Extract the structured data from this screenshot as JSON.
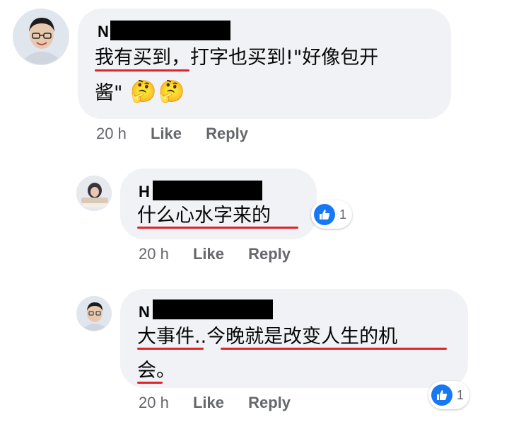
{
  "comments": [
    {
      "author_initial": "N",
      "text_line1": "我有买到，打字也买到!\"好像包开",
      "text_line2": "酱\"",
      "emoji_1": "🤔",
      "emoji_2": "🤔",
      "time": "20 h",
      "like_label": "Like",
      "reply_label": "Reply"
    },
    {
      "author_initial": "H",
      "text_line1": "什么心水字来的",
      "time": "20 h",
      "like_label": "Like",
      "reply_label": "Reply",
      "reaction_count": "1"
    },
    {
      "author_initial": "N",
      "text_line1": "大事件..今晚就是改变人生的机",
      "text_line2": "会。",
      "time": "20 h",
      "like_label": "Like",
      "reply_label": "Reply",
      "reaction_count": "1"
    }
  ],
  "colors": {
    "bubble": "#f0f2f5",
    "meta_text": "#65676b",
    "underline": "#e0242b",
    "like_blue": "#1877f2"
  },
  "icons": {
    "reaction": "thumbs-up-icon"
  }
}
